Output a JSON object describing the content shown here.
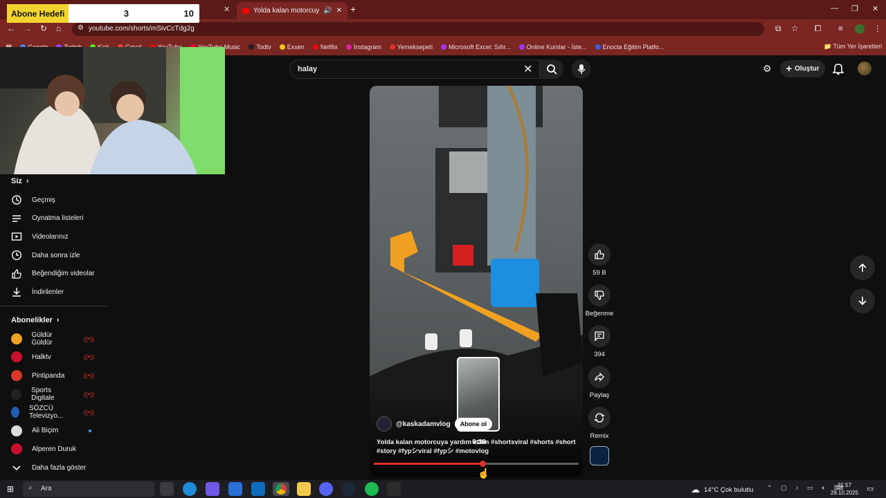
{
  "overlay": {
    "goal_label": "Abone Hedefi",
    "goal_current": "3",
    "goal_target": "10"
  },
  "browser": {
    "tab_title": "Yolda kalan motorcuya yard",
    "url": "youtube.com/shorts/mSivCcTdg2g",
    "bookmarks": [
      "Google",
      "Twitch",
      "Kick",
      "Gmail",
      "YouTube",
      "YouTube Music",
      "Todtv",
      "Exxen",
      "Netflix",
      "İnstagram",
      "Yemeksepeti",
      "Microsoft Excel: Sıfır...",
      "Online Kurslar - İste...",
      "Enocta Eğitim Platfo..."
    ],
    "bookmark_colors": [
      "#4285f4",
      "#9146ff",
      "#53fc18",
      "#ea4335",
      "#ff0000",
      "#ff0033",
      "#222222",
      "#f5c518",
      "#e50914",
      "#d6249f",
      "#e0312b",
      "#a435f0",
      "#a435f0",
      "#3b5bdb"
    ],
    "all_bookmarks": "Tüm Yer İşaretleri"
  },
  "youtube": {
    "search_value": "halay",
    "create_label": "Oluştur",
    "sidebar": {
      "you_title": "Siz",
      "you_items": [
        {
          "label": "Geçmiş",
          "icon": "history-icon"
        },
        {
          "label": "Oynatma listeleri",
          "icon": "playlist-icon"
        },
        {
          "label": "Videolarınız",
          "icon": "your-videos-icon"
        },
        {
          "label": "Daha sonra izle",
          "icon": "watch-later-icon"
        },
        {
          "label": "Beğendiğim videolar",
          "icon": "liked-icon"
        },
        {
          "label": "İndirilenler",
          "icon": "download-icon"
        }
      ],
      "subs_title": "Abonelikler",
      "channels": [
        {
          "name": "Güldür Güldür",
          "status": "live",
          "color": "#f0a020"
        },
        {
          "name": "Halktv",
          "status": "live",
          "color": "#c8102e"
        },
        {
          "name": "Pintipanda",
          "status": "live",
          "color": "#d63a2a"
        },
        {
          "name": "Sports Digitale",
          "status": "live",
          "color": "#222222"
        },
        {
          "name": "SÖZCÜ Televizyo...",
          "status": "live",
          "color": "#1f5fb3"
        },
        {
          "name": "Ali Biçim",
          "status": "new",
          "color": "#dddddd"
        },
        {
          "name": "Alperen Duruk",
          "status": "",
          "color": "#c8102e"
        }
      ],
      "show_more": "Daha fazla göster"
    },
    "short": {
      "channel": "@kaskadamvlog",
      "subscribe_label": "Abone ol",
      "description": "Yolda kalan motorcuya yardım ettim #shortsviral #shorts #short #story #fypシviral #fypシ #motovlog",
      "preview_time": "0:30",
      "progress": 0.53,
      "likes": "59 B",
      "dislike_label": "Beğenme",
      "comments": "394",
      "share_label": "Paylaş",
      "remix_label": "Remix"
    }
  },
  "taskbar": {
    "search_placeholder": "Ara",
    "weather": "14°C  Çok bulutlu",
    "time": "21:57",
    "date": "28.10.2025"
  }
}
